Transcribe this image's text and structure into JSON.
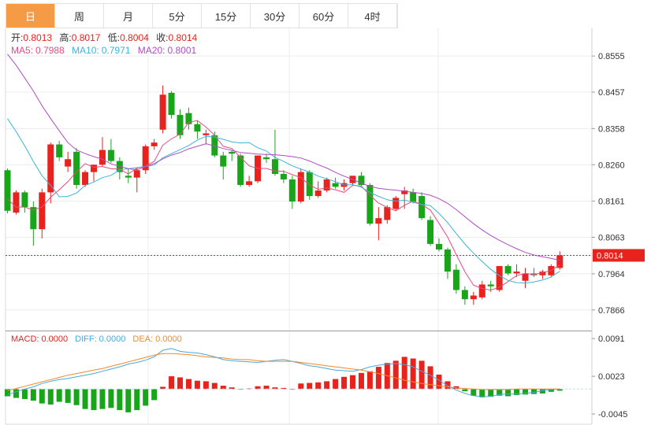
{
  "tabs": [
    {
      "label": "日",
      "active": true
    },
    {
      "label": "周"
    },
    {
      "label": "月"
    },
    {
      "label": "5分"
    },
    {
      "label": "15分"
    },
    {
      "label": "30分"
    },
    {
      "label": "60分"
    },
    {
      "label": "4时"
    }
  ],
  "ohlc_info": {
    "open_label": "开:",
    "open": "0.8013",
    "high_label": "高:",
    "high": "0.8017",
    "low_label": "低:",
    "low": "0.8004",
    "close_label": "收:",
    "close": "0.8014"
  },
  "ma_info": {
    "ma5_label": "MA5:",
    "ma5": "0.7988",
    "ma10_label": "MA10:",
    "ma10": "0.7971",
    "ma20_label": "MA20:",
    "ma20": "0.8001"
  },
  "macd_info": {
    "macd_label": "MACD:",
    "macd": "0.0000",
    "diff_label": "DIFF:",
    "diff": "0.0000",
    "dea_label": "DEA:",
    "dea": "0.0000"
  },
  "last_price_tag": "0.8014",
  "colors": {
    "up": "#e8221d",
    "down": "#18a51a",
    "ma5": "#e64c7e",
    "ma10": "#3cb5d8",
    "ma20": "#b04cc4",
    "diff": "#4aa8d8",
    "dea": "#ef8a2a",
    "tab_active": "#f59a45",
    "last_price": "#e8221d",
    "grid": "#ececec"
  },
  "chart_data": [
    {
      "type": "candlestick",
      "title": "",
      "y_ticks": [
        "0.8555",
        "0.8457",
        "0.8358",
        "0.8260",
        "0.8161",
        "0.8063",
        "0.7964",
        "0.7866"
      ],
      "ylim": [
        0.781,
        0.863
      ],
      "grid": true,
      "last_price": 0.8014,
      "candles": [
        [
          0.8245,
          0.825,
          0.8128,
          0.8135
        ],
        [
          0.813,
          0.819,
          0.8125,
          0.8185
        ],
        [
          0.8185,
          0.819,
          0.813,
          0.8145
        ],
        [
          0.8145,
          0.816,
          0.804,
          0.8085
        ],
        [
          0.8085,
          0.8195,
          0.806,
          0.8185
        ],
        [
          0.8185,
          0.832,
          0.8155,
          0.8315
        ],
        [
          0.8315,
          0.8325,
          0.827,
          0.828
        ],
        [
          0.8255,
          0.8295,
          0.824,
          0.8275
        ],
        [
          0.8295,
          0.8305,
          0.8195,
          0.8205
        ],
        [
          0.8205,
          0.8245,
          0.82,
          0.824
        ],
        [
          0.824,
          0.826,
          0.8215,
          0.826
        ],
        [
          0.826,
          0.8335,
          0.8255,
          0.83
        ],
        [
          0.83,
          0.833,
          0.8265,
          0.827
        ],
        [
          0.827,
          0.828,
          0.822,
          0.824
        ],
        [
          0.823,
          0.825,
          0.821,
          0.8225
        ],
        [
          0.8225,
          0.825,
          0.8185,
          0.8245
        ],
        [
          0.8245,
          0.8315,
          0.8235,
          0.831
        ],
        [
          0.831,
          0.833,
          0.83,
          0.832
        ],
        [
          0.8355,
          0.8475,
          0.8345,
          0.845
        ],
        [
          0.8455,
          0.846,
          0.8385,
          0.8395
        ],
        [
          0.8395,
          0.841,
          0.833,
          0.834
        ],
        [
          0.84,
          0.8415,
          0.8355,
          0.837
        ],
        [
          0.837,
          0.838,
          0.833,
          0.835
        ],
        [
          0.834,
          0.8355,
          0.8315,
          0.8345
        ],
        [
          0.834,
          0.835,
          0.828,
          0.8285
        ],
        [
          0.8285,
          0.8295,
          0.822,
          0.8255
        ],
        [
          0.8295,
          0.83,
          0.827,
          0.829
        ],
        [
          0.8285,
          0.829,
          0.82,
          0.8205
        ],
        [
          0.8205,
          0.823,
          0.82,
          0.8215
        ],
        [
          0.8215,
          0.8285,
          0.821,
          0.8285
        ],
        [
          0.828,
          0.829,
          0.8265,
          0.8275
        ],
        [
          0.8275,
          0.8355,
          0.823,
          0.8235
        ],
        [
          0.8235,
          0.8245,
          0.821,
          0.822
        ],
        [
          0.822,
          0.823,
          0.814,
          0.816
        ],
        [
          0.816,
          0.825,
          0.8155,
          0.824
        ],
        [
          0.824,
          0.8245,
          0.8165,
          0.8175
        ],
        [
          0.8175,
          0.8215,
          0.817,
          0.819
        ],
        [
          0.819,
          0.8225,
          0.8185,
          0.822
        ],
        [
          0.821,
          0.8225,
          0.8195,
          0.82
        ],
        [
          0.82,
          0.822,
          0.819,
          0.821
        ],
        [
          0.821,
          0.823,
          0.8205,
          0.823
        ],
        [
          0.823,
          0.824,
          0.82,
          0.8205
        ],
        [
          0.8205,
          0.821,
          0.8095,
          0.81
        ],
        [
          0.81,
          0.8145,
          0.8055,
          0.8115
        ],
        [
          0.811,
          0.815,
          0.81,
          0.8145
        ],
        [
          0.814,
          0.8175,
          0.8135,
          0.817
        ],
        [
          0.818,
          0.82,
          0.814,
          0.819
        ],
        [
          0.8185,
          0.8195,
          0.8155,
          0.816
        ],
        [
          0.8175,
          0.8185,
          0.811,
          0.8115
        ],
        [
          0.811,
          0.812,
          0.804,
          0.8045
        ],
        [
          0.8045,
          0.806,
          0.8025,
          0.803
        ],
        [
          0.803,
          0.8035,
          0.795,
          0.797
        ],
        [
          0.7975,
          0.799,
          0.791,
          0.792
        ],
        [
          0.792,
          0.793,
          0.788,
          0.7895
        ],
        [
          0.7895,
          0.7915,
          0.788,
          0.7905
        ],
        [
          0.79,
          0.7945,
          0.7895,
          0.7935
        ],
        [
          0.7935,
          0.7945,
          0.7915,
          0.793
        ],
        [
          0.792,
          0.7985,
          0.7915,
          0.7985
        ],
        [
          0.7985,
          0.799,
          0.796,
          0.7965
        ],
        [
          0.7965,
          0.799,
          0.7955,
          0.797
        ],
        [
          0.7945,
          0.798,
          0.7925,
          0.7965
        ],
        [
          0.7965,
          0.798,
          0.7955,
          0.796
        ],
        [
          0.796,
          0.7975,
          0.795,
          0.797
        ],
        [
          0.796,
          0.799,
          0.7955,
          0.7985
        ],
        [
          0.798,
          0.8025,
          0.7975,
          0.8014
        ]
      ],
      "ma5": [
        0.8167,
        0.8145,
        0.8145,
        0.8137,
        0.8145,
        0.8172,
        0.8192,
        0.8214,
        0.8241,
        0.8263,
        0.8253,
        0.8255,
        0.8249,
        0.8248,
        0.8235,
        0.8251,
        0.8256,
        0.8269,
        0.8313,
        0.833,
        0.8343,
        0.8375,
        0.838,
        0.8362,
        0.834,
        0.831,
        0.8304,
        0.828,
        0.8257,
        0.825,
        0.825,
        0.8243,
        0.8242,
        0.8233,
        0.8225,
        0.8205,
        0.8193,
        0.8197,
        0.8192,
        0.8185,
        0.8204,
        0.8202,
        0.8177,
        0.8156,
        0.8144,
        0.8135,
        0.815,
        0.8161,
        0.8152,
        0.8137,
        0.8101,
        0.8064,
        0.8016,
        0.797,
        0.7933,
        0.7924,
        0.792,
        0.7927,
        0.7943,
        0.7959,
        0.7965,
        0.7962,
        0.7967,
        0.7973,
        0.7988
      ],
      "ma10": [
        0.8385,
        0.835,
        0.8311,
        0.8269,
        0.823,
        0.8204,
        0.8173,
        0.8174,
        0.8183,
        0.8204,
        0.8213,
        0.8225,
        0.8231,
        0.8246,
        0.8249,
        0.8252,
        0.8255,
        0.8259,
        0.8279,
        0.829,
        0.8301,
        0.8312,
        0.8327,
        0.8337,
        0.8335,
        0.8329,
        0.8322,
        0.8319,
        0.832,
        0.8306,
        0.8297,
        0.828,
        0.8269,
        0.8257,
        0.8248,
        0.824,
        0.8229,
        0.8222,
        0.8214,
        0.8205,
        0.8206,
        0.8199,
        0.8185,
        0.8174,
        0.8165,
        0.8161,
        0.8164,
        0.8158,
        0.8152,
        0.8149,
        0.8128,
        0.8103,
        0.8073,
        0.8045,
        0.802,
        0.7997,
        0.7976,
        0.7959,
        0.7946,
        0.794,
        0.7939,
        0.7942,
        0.7947,
        0.7955,
        0.7971
      ],
      "ma20": [
        0.856,
        0.853,
        0.8495,
        0.846,
        0.842,
        0.8385,
        0.8352,
        0.832,
        0.83,
        0.829,
        0.8282,
        0.8275,
        0.8262,
        0.8256,
        0.8249,
        0.8246,
        0.8255,
        0.8263,
        0.8276,
        0.8286,
        0.8293,
        0.8303,
        0.831,
        0.8317,
        0.8311,
        0.8304,
        0.8299,
        0.8293,
        0.8291,
        0.8289,
        0.8288,
        0.8287,
        0.8285,
        0.8282,
        0.8278,
        0.827,
        0.826,
        0.8251,
        0.8239,
        0.8229,
        0.822,
        0.821,
        0.8201,
        0.8196,
        0.8193,
        0.8191,
        0.8188,
        0.8185,
        0.8182,
        0.8177,
        0.8168,
        0.8155,
        0.8138,
        0.8119,
        0.81,
        0.8083,
        0.8068,
        0.8055,
        0.8043,
        0.8032,
        0.8022,
        0.8015,
        0.801,
        0.8006,
        0.8001
      ]
    },
    {
      "type": "bar+line",
      "title": "",
      "y_ticks": [
        "0.0091",
        "0.0023",
        "-0.0045"
      ],
      "ylim": [
        -0.0062,
        0.0104
      ],
      "macd": [
        -0.0013,
        -0.0016,
        -0.0018,
        -0.0021,
        -0.0026,
        -0.0028,
        -0.0023,
        -0.0025,
        -0.0029,
        -0.0036,
        -0.0038,
        -0.0036,
        -0.0034,
        -0.0038,
        -0.0042,
        -0.0038,
        -0.003,
        -0.002,
        0.0004,
        0.0023,
        0.0021,
        0.0018,
        0.0015,
        0.0014,
        0.0011,
        0.0006,
        0.0003,
        -0.0001,
        0.0001,
        0.0005,
        0.0006,
        0.0003,
        0.0002,
        0.0,
        0.001,
        0.0011,
        0.0012,
        0.0014,
        0.0018,
        0.0022,
        0.0025,
        0.0029,
        0.0032,
        0.004,
        0.0047,
        0.0051,
        0.0058,
        0.0055,
        0.0051,
        0.0041,
        0.0026,
        0.0014,
        0.0005,
        -0.0004,
        -0.0012,
        -0.0015,
        -0.0014,
        -0.0012,
        -0.0013,
        -0.0011,
        -0.001,
        -0.0009,
        -0.0008,
        -0.0005,
        -0.0003
      ],
      "diff": [
        -0.001,
        -0.0005,
        0.0,
        0.0004,
        0.001,
        0.0014,
        0.0017,
        0.0019,
        0.0022,
        0.0025,
        0.0028,
        0.0032,
        0.0036,
        0.004,
        0.0045,
        0.0048,
        0.0052,
        0.0058,
        0.007,
        0.0073,
        0.0068,
        0.0066,
        0.0065,
        0.0062,
        0.0058,
        0.0053,
        0.0051,
        0.005,
        0.0049,
        0.0048,
        0.005,
        0.0052,
        0.0053,
        0.005,
        0.0046,
        0.0042,
        0.004,
        0.0037,
        0.0034,
        0.0033,
        0.0032,
        0.0035,
        0.004,
        0.0043,
        0.0045,
        0.0046,
        0.0044,
        0.004,
        0.0032,
        0.0025,
        0.0016,
        0.0006,
        -0.0002,
        -0.0008,
        -0.0012,
        -0.0014,
        -0.0013,
        -0.001,
        -0.0009,
        -0.0009,
        -0.0008,
        -0.0006,
        -0.0003,
        -0.0001,
        0.0
      ],
      "dea": [
        -0.0003,
        0.0001,
        0.0005,
        0.0009,
        0.0013,
        0.0017,
        0.0021,
        0.0025,
        0.0028,
        0.0031,
        0.0034,
        0.0037,
        0.0041,
        0.0045,
        0.0049,
        0.0053,
        0.0057,
        0.0061,
        0.0064,
        0.0064,
        0.0063,
        0.0062,
        0.006,
        0.0058,
        0.0057,
        0.0056,
        0.0054,
        0.0053,
        0.0053,
        0.0051,
        0.005,
        0.005,
        0.005,
        0.005,
        0.0048,
        0.0046,
        0.0044,
        0.0042,
        0.004,
        0.0038,
        0.0036,
        0.0034,
        0.0031,
        0.0028,
        0.0024,
        0.002,
        0.0016,
        0.0013,
        0.001,
        0.0008,
        0.0006,
        0.0004,
        0.0002,
        0.0001,
        0.0,
        -0.0001,
        -0.0001,
        -0.0001,
        -0.0001,
        0.0,
        0.0,
        0.0,
        0.0,
        0.0,
        0.0
      ]
    }
  ]
}
